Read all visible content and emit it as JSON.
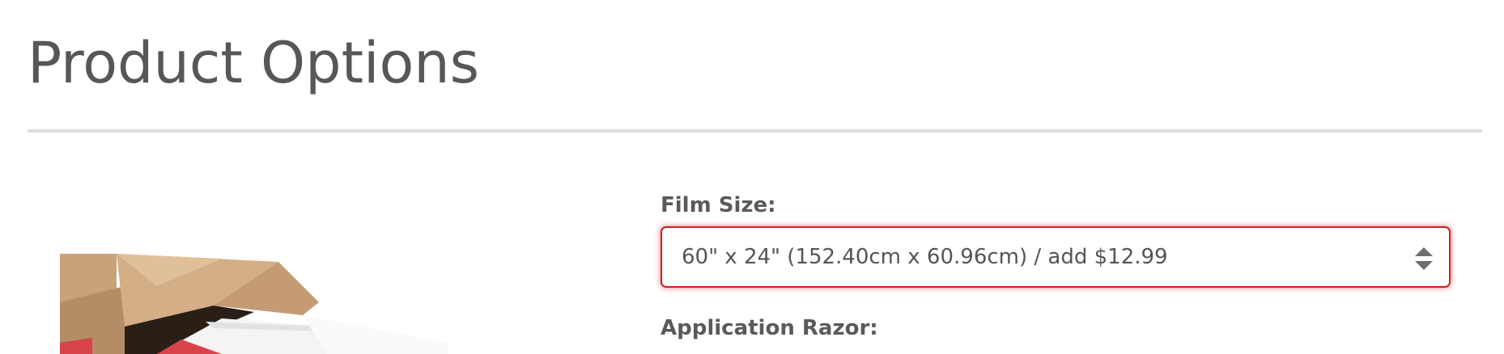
{
  "page": {
    "title": "Product Options"
  },
  "product_image": {
    "icon": "product-box-image",
    "colors": {
      "cardboard": "#c9a27a",
      "cardboard_dark": "#a8825e",
      "film_red": "#d8444a",
      "film_white": "#f4f4f4"
    }
  },
  "options": {
    "film_size": {
      "label": "Film Size:",
      "selected": "60\" x 24\" (152.40cm x 60.96cm) / add $12.99",
      "icon": "select-arrows-icon"
    },
    "application_razor": {
      "label": "Application Razor:"
    }
  },
  "colors": {
    "focus_border": "#cf1f24",
    "divider": "#dedede",
    "text": "#555555"
  }
}
